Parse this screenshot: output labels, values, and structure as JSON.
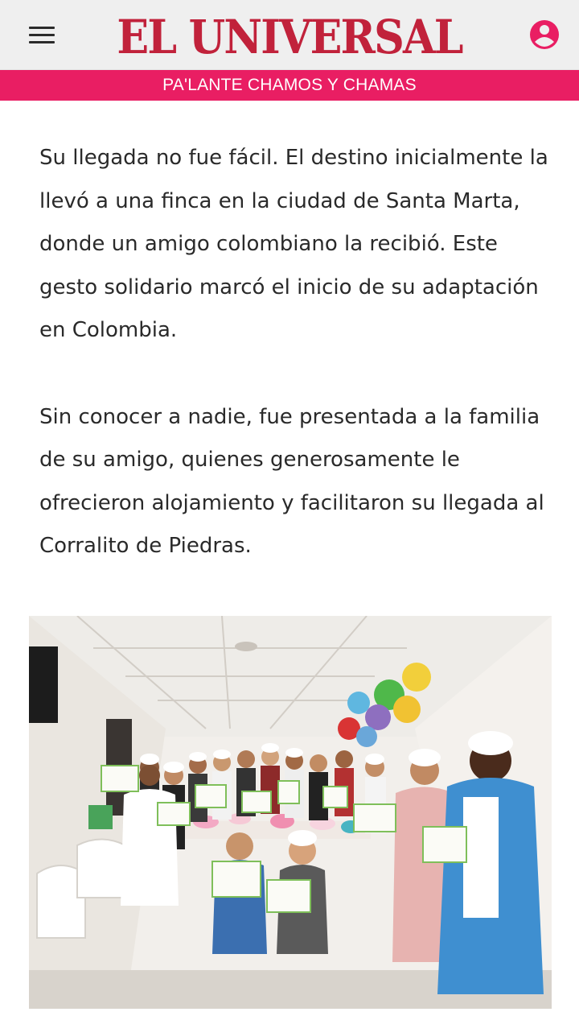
{
  "header": {
    "logo_text": "EL UNIVERSAL",
    "menu_icon": "hamburger-menu-icon",
    "user_icon": "account-circle-icon",
    "brand_color": "#c1223b"
  },
  "section_strip": {
    "label": "PA'LANTE CHAMOS Y CHAMAS",
    "color": "#e91e63"
  },
  "article": {
    "paragraphs": [
      "Su llegada no fue fácil. El destino inicialmente la llevó a una finca en la ciudad de Santa Marta, donde un amigo colombiano la recibió. Este gesto solidario marcó el inicio de su adaptación en Colombia.",
      "Sin conocer a nadie, fue presentada a la familia de su amigo, quienes generosamente le ofrecieron alojamiento y facilitaron su llegada al Corralito de Piedras."
    ]
  }
}
